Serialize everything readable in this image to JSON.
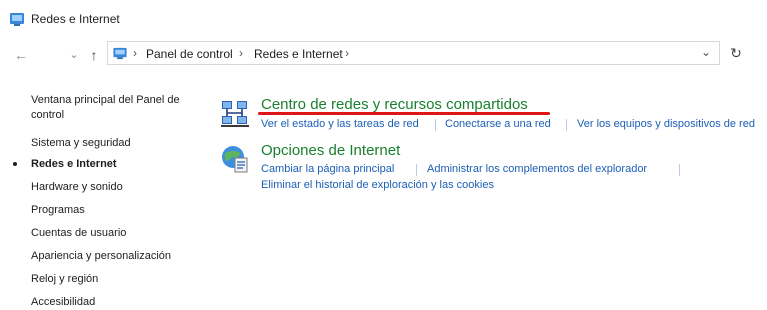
{
  "window": {
    "title": "Redes e Internet"
  },
  "navigation": {
    "back_glyph": "←",
    "recent_glyph": "⌄",
    "up_glyph": "↑",
    "breadcrumb": [
      "Panel de control",
      "Redes e Internet"
    ],
    "separator_glyph": "›",
    "dropdown_glyph": "⌄",
    "refresh_glyph": "↻"
  },
  "sidebar": {
    "items": [
      {
        "label": "Ventana principal del Panel de control",
        "active": false
      },
      {
        "label": "Sistema y seguridad",
        "active": false
      },
      {
        "label": "Redes e Internet",
        "active": true
      },
      {
        "label": "Hardware y sonido",
        "active": false
      },
      {
        "label": "Programas",
        "active": false
      },
      {
        "label": "Cuentas de usuario",
        "active": false
      },
      {
        "label": "Apariencia y personalización",
        "active": false
      },
      {
        "label": "Reloj y región",
        "active": false
      },
      {
        "label": "Accesibilidad",
        "active": false
      }
    ]
  },
  "categories": [
    {
      "title": "Centro de redes y recursos compartidos",
      "icon": "network-center-icon",
      "links": [
        "Ver el estado y las tareas de red",
        "Conectarse a una red",
        "Ver los equipos y dispositivos de red"
      ]
    },
    {
      "title": "Opciones de Internet",
      "icon": "internet-options-icon",
      "links": [
        "Cambiar la página principal",
        "Administrar los complementos del explorador",
        "Eliminar el historial de exploración y las cookies"
      ]
    }
  ],
  "colors": {
    "category_title": "#1a7f2e",
    "link": "#1d5fb5",
    "annotation_underline": "#e01616"
  }
}
